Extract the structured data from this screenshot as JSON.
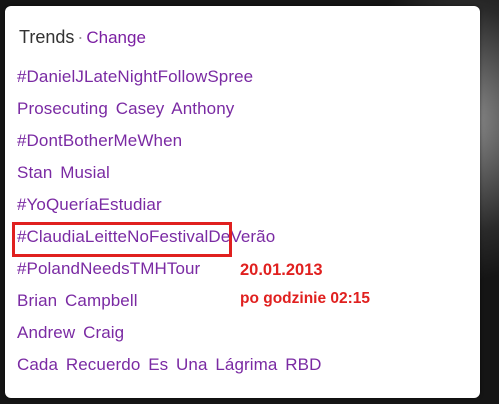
{
  "widget": {
    "title": "Trends",
    "separator": "·",
    "change_label": "Change"
  },
  "trends": [
    "#DanielJLateNightFollowSpree",
    "Prosecuting Casey Anthony",
    "#DontBotherMeWhen",
    "Stan Musial",
    "#YoQueríaEstudiar",
    "#ClaudiaLeitteNoFestivalDeVerão",
    "#PolandNeedsTMHTour",
    "Brian Campbell",
    "Andrew Craig",
    "Cada Recuerdo Es Una Lágrima RBD"
  ],
  "annotation": {
    "date": "20.01.2013",
    "time": "po godzinie 02:15",
    "highlighted_trend": "#PolandNeedsTMHTour",
    "color": "#e0201f"
  },
  "colors": {
    "link": "#7a2aa3",
    "title": "#333333",
    "panel_bg": "#ffffff"
  }
}
